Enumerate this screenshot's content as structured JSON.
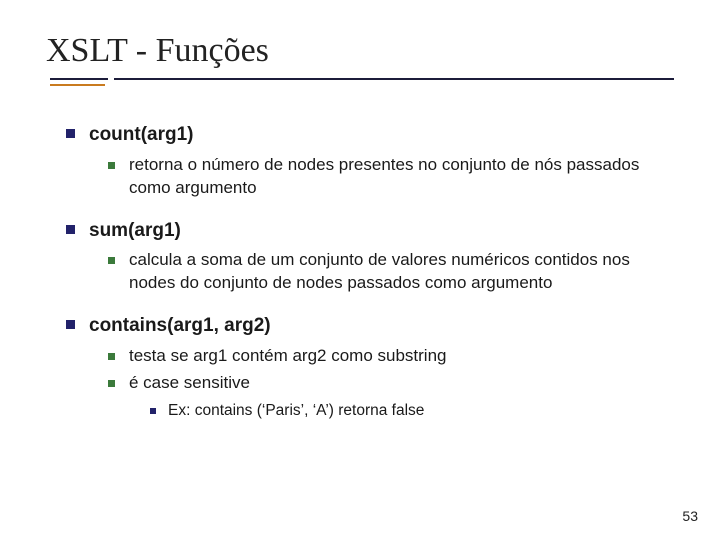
{
  "title": "XSLT - Funções",
  "items": [
    {
      "label": "count(arg1)",
      "sub": [
        "retorna o número de nodes presentes no conjunto de nós passados como argumento"
      ]
    },
    {
      "label": "sum(arg1)",
      "sub": [
        "calcula a soma de um conjunto de valores numéricos contidos nos nodes do conjunto de nodes passados como argumento"
      ]
    },
    {
      "label": "contains(arg1, arg2)",
      "sub": [
        "testa se arg1 contém arg2 como substring",
        "é case sensitive"
      ],
      "subsub_after": 1,
      "subsub": [
        "Ex: contains (‘Paris’,  ‘A’)  retorna false"
      ]
    }
  ],
  "page_number": "53"
}
